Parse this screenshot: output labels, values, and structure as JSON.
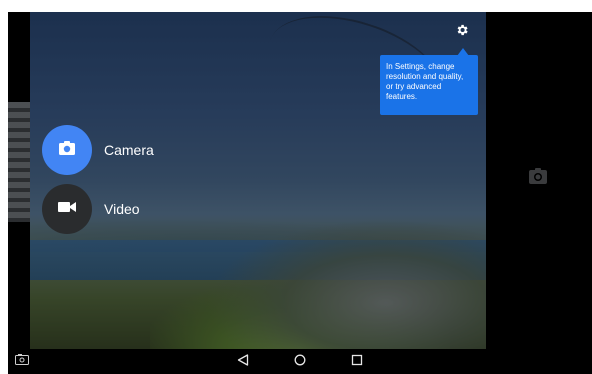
{
  "modes": {
    "camera": {
      "label": "Camera",
      "icon": "camera-icon"
    },
    "video": {
      "label": "Video",
      "icon": "videocam-icon"
    }
  },
  "settings": {
    "icon": "gear-icon"
  },
  "tooltip": {
    "text": "In Settings, change resolution and quality, or try advanced features."
  },
  "navbar": {
    "back_icon": "back-triangle-icon",
    "home_icon": "home-circle-icon",
    "recents_icon": "recents-square-icon",
    "screenshot_icon": "screenshot-icon"
  },
  "colors": {
    "accent": "#4285f4",
    "tooltip_bg": "#1a73e8",
    "video_btn_bg": "#2a2c2e"
  }
}
